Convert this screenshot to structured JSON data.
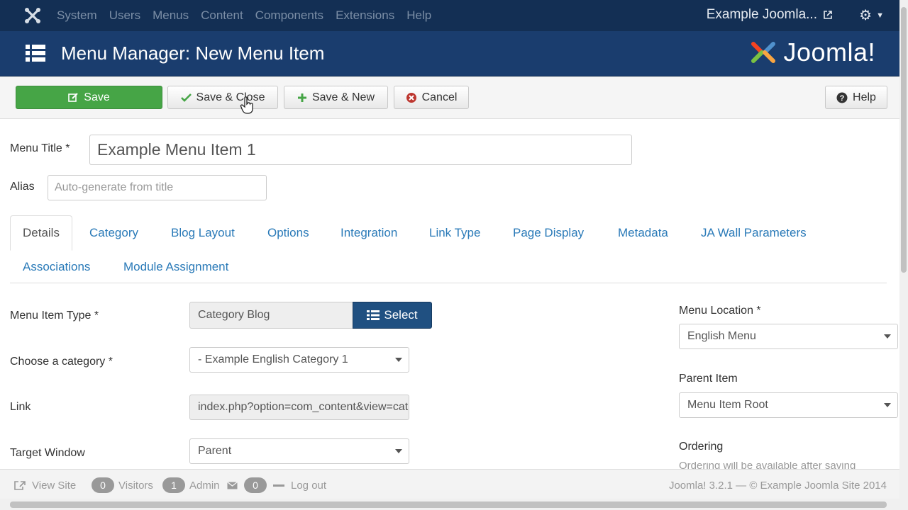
{
  "navbar": {
    "menu": [
      "System",
      "Users",
      "Menus",
      "Content",
      "Components",
      "Extensions",
      "Help"
    ],
    "site_link": "Example Joomla...",
    "logo_icon": "joomla-logo-icon",
    "settings_icon": "gear-icon"
  },
  "header": {
    "title": "Menu Manager: New Menu Item",
    "brand": "Joomla!",
    "icon": "list-icon"
  },
  "toolbar": {
    "save": "Save",
    "save_close": "Save & Close",
    "save_new": "Save & New",
    "cancel": "Cancel",
    "help": "Help"
  },
  "form": {
    "menu_title_label": "Menu Title *",
    "menu_title_value": "Example Menu Item 1",
    "alias_label": "Alias",
    "alias_placeholder": "Auto-generate from title"
  },
  "tabs": [
    {
      "label": "Details",
      "active": true
    },
    {
      "label": "Category"
    },
    {
      "label": "Blog Layout"
    },
    {
      "label": "Options"
    },
    {
      "label": "Integration"
    },
    {
      "label": "Link Type"
    },
    {
      "label": "Page Display"
    },
    {
      "label": "Metadata"
    },
    {
      "label": "JA Wall Parameters"
    },
    {
      "label": "Associations"
    },
    {
      "label": "Module Assignment"
    }
  ],
  "details": {
    "menu_item_type_label": "Menu Item Type *",
    "menu_item_type_value": "Category Blog",
    "select_button": "Select",
    "choose_category_label": "Choose a category *",
    "choose_category_value": "- Example English Category 1",
    "link_label": "Link",
    "link_value": "index.php?option=com_content&view=category&layout=blog",
    "target_window_label": "Target Window",
    "target_window_value": "Parent",
    "menu_location_label": "Menu Location *",
    "menu_location_value": "English Menu",
    "parent_item_label": "Parent Item",
    "parent_item_value": "Menu Item Root",
    "ordering_label": "Ordering",
    "ordering_note": "Ordering will be available after saving"
  },
  "statusbar": {
    "view_site": "View Site",
    "visitors_count": "0",
    "visitors": "Visitors",
    "admin_count": "1",
    "admin": "Admin",
    "messages_count": "0",
    "logout": "Log out",
    "footer": "Joomla! 3.2.1 — © Example Joomla Site 2014"
  },
  "colors": {
    "navbar": "#132f54",
    "header": "#1a3d6e",
    "save_green": "#46a546",
    "select_blue": "#205081",
    "link_blue": "#2a7ab8"
  }
}
